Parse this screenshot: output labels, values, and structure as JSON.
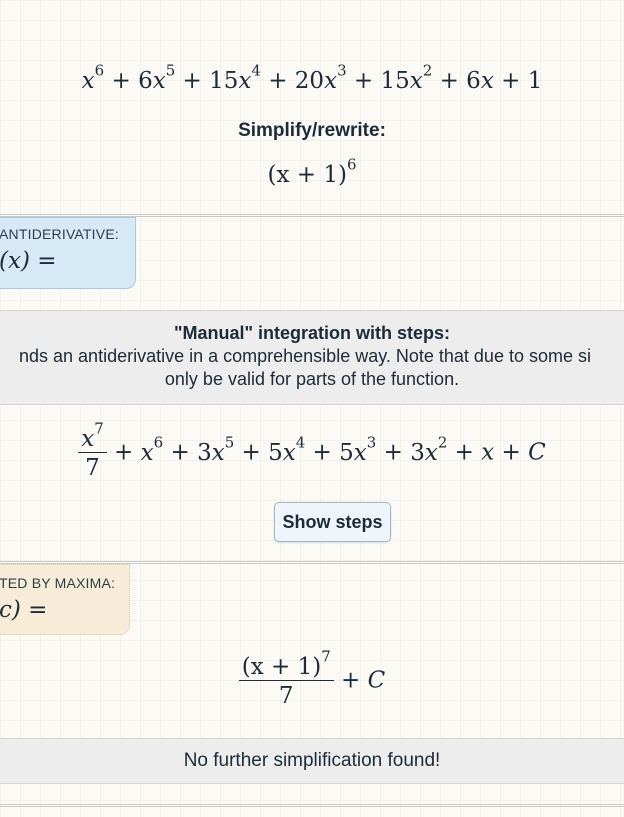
{
  "expression": {
    "terms": [
      {
        "coef": "",
        "exp": "6"
      },
      {
        "coef": "6",
        "exp": "5"
      },
      {
        "coef": "15",
        "exp": "4"
      },
      {
        "coef": "20",
        "exp": "3"
      },
      {
        "coef": "15",
        "exp": "2"
      },
      {
        "coef": "6",
        "exp": ""
      }
    ],
    "constant": "1"
  },
  "simplify": {
    "label": "Simplify/rewrite:",
    "base": "(x + 1)",
    "exp": "6"
  },
  "antiderivative": {
    "tag_label": "ANTIDERIVATIVE:",
    "tag_math": "(x) ="
  },
  "manual": {
    "title": "\"Manual\" integration with steps:",
    "line1": "nds an antiderivative in a comprehensible way. Note that due to some si",
    "line2": "only be valid for parts of the function."
  },
  "result_manual": {
    "frac_num_var": "x",
    "frac_num_exp": "7",
    "frac_den": "7",
    "rest_terms": [
      {
        "coef": "",
        "exp": "6"
      },
      {
        "coef": "3",
        "exp": "5"
      },
      {
        "coef": "5",
        "exp": "4"
      },
      {
        "coef": "5",
        "exp": "3"
      },
      {
        "coef": "3",
        "exp": "2"
      },
      {
        "coef": "",
        "exp": ""
      }
    ],
    "constant": "C"
  },
  "show_steps_label": "Show steps",
  "maxima": {
    "tag_label": "TED BY MAXIMA:",
    "tag_math": "c) ="
  },
  "result_maxima": {
    "num": "(x + 1)",
    "num_exp": "7",
    "den": "7",
    "constant": "C"
  },
  "footer_message": "No further simplification found!"
}
